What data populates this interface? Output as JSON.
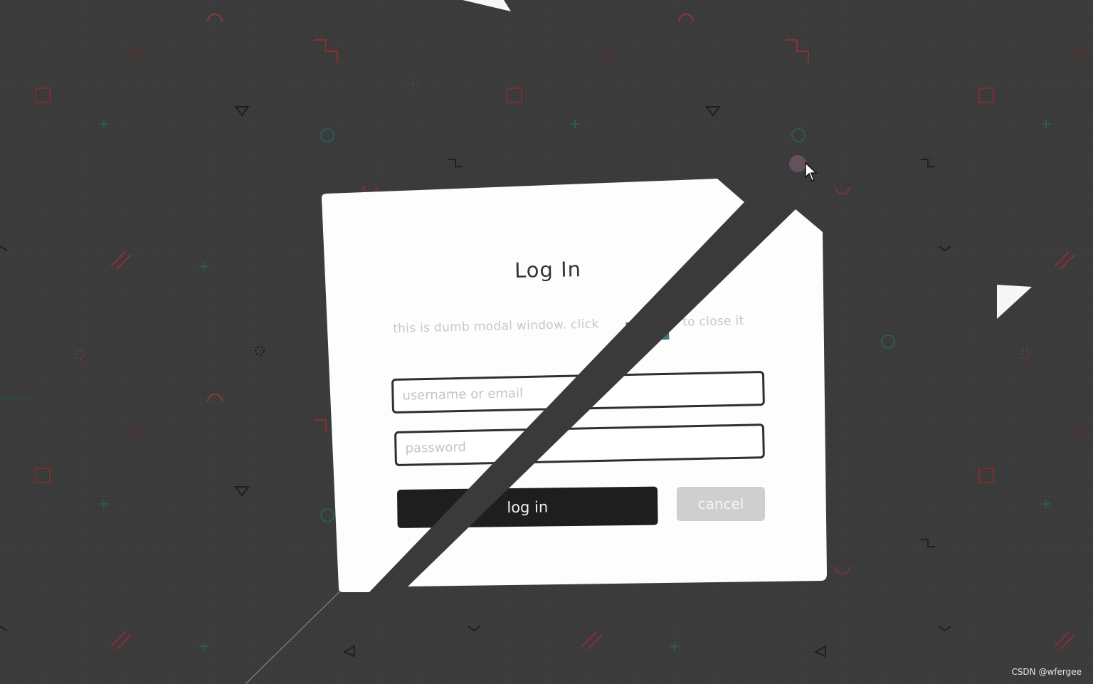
{
  "modal": {
    "title": "Log In",
    "subtitle": "this is dumb modal window. click",
    "subtitle_tail": "to close it",
    "close_glyph": "×",
    "username_placeholder": "username or email",
    "password_placeholder": "password",
    "login_label": "log in",
    "cancel_label": "cancel"
  },
  "watermark": "CSDN @wfergee",
  "colors": {
    "background": "#3a3a3a",
    "modal": "#fdfdfd",
    "login_button": "#1e1e1e",
    "cancel_button": "#cfcfcf",
    "input_border": "#2f2f2f",
    "accent_teal": "#1f5f63"
  },
  "icons": {
    "cursor": "arrow-cursor-icon"
  }
}
